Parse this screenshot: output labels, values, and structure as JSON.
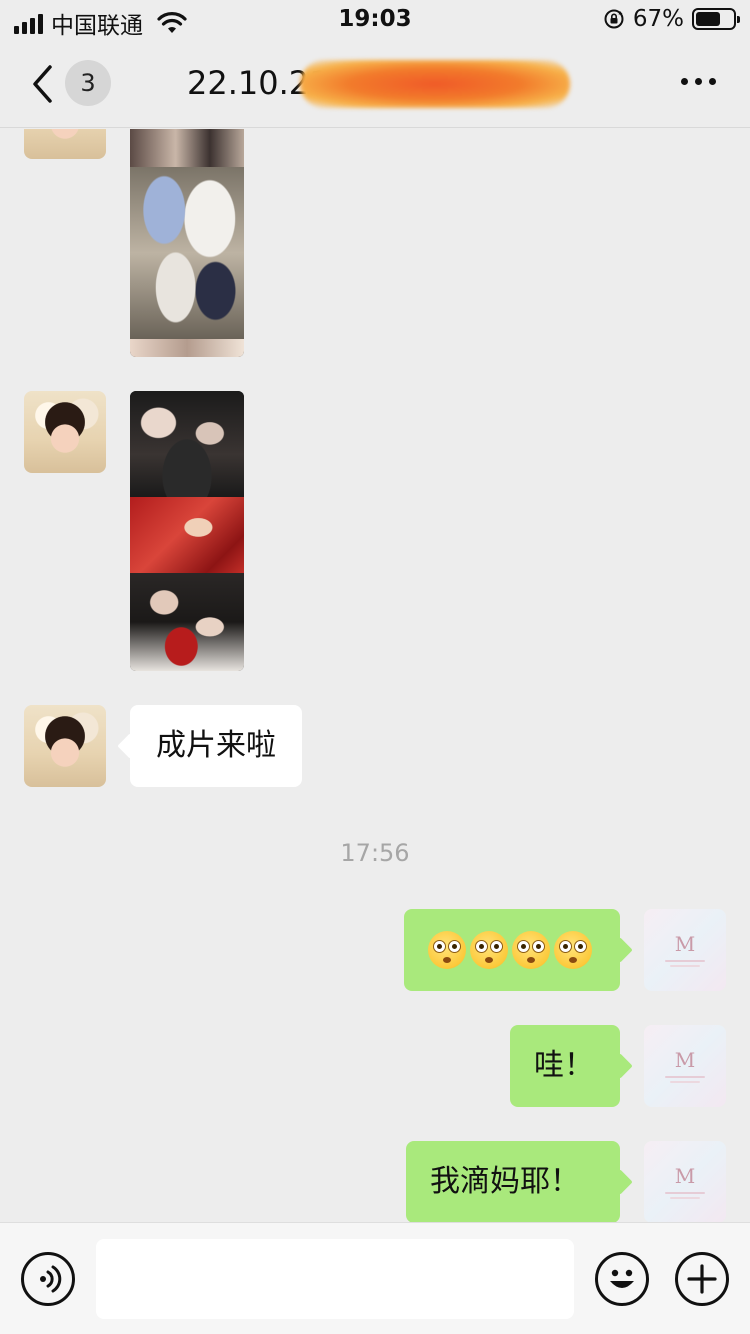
{
  "status_bar": {
    "carrier": "中国联通",
    "time": "19:03",
    "battery_percent": "67%",
    "battery_level": 0.67,
    "icons": [
      "signal-icon",
      "wifi-icon",
      "rotation-lock-icon",
      "battery-icon"
    ]
  },
  "nav": {
    "unread_count": "3",
    "title": "22.10.21",
    "icons": [
      "back-chevron-icon",
      "more-dots-icon"
    ]
  },
  "messages": {
    "text_1": "成片来啦",
    "timestamp": "17:56",
    "emoji_count": 4,
    "emoji_name": "flushed-face-emoji",
    "text_2": "哇！",
    "text_3": "我滴妈耶！"
  },
  "input_bar": {
    "placeholder": "",
    "icons": [
      "voice-icon",
      "emoji-icon",
      "plus-icon"
    ]
  },
  "colors": {
    "background": "#ededed",
    "incoming_bubble": "#ffffff",
    "outgoing_bubble": "#a9e97c",
    "timestamp_text": "#a6a6a6"
  }
}
